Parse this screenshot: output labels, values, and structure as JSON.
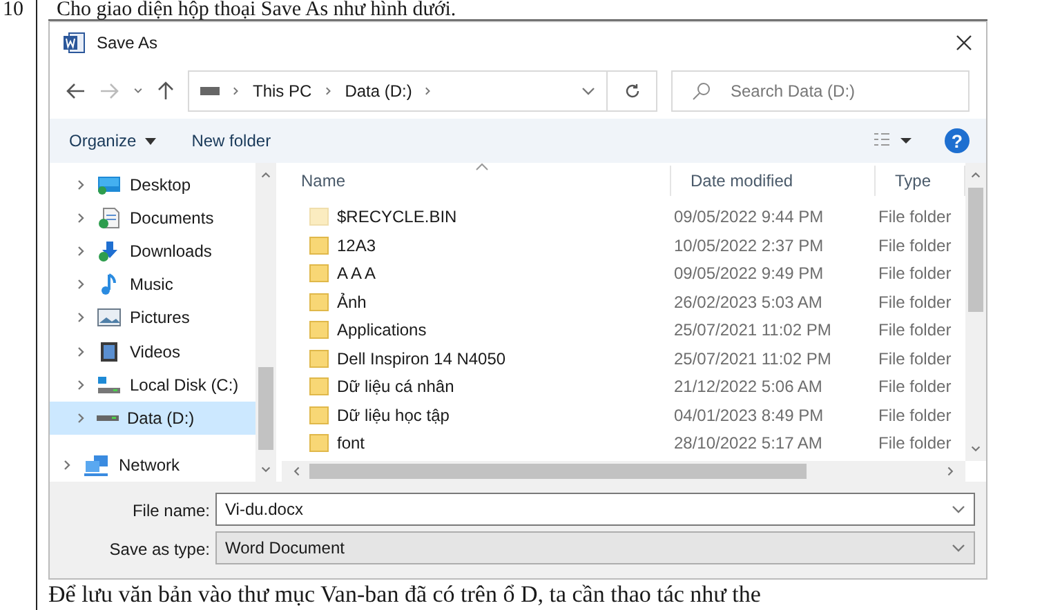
{
  "question": {
    "number": "10",
    "text": "Cho giao diện hộp thoại Save As như hình dưới."
  },
  "window": {
    "title": "Save As"
  },
  "address_bar": {
    "crumbs": [
      "This PC",
      "Data (D:)"
    ]
  },
  "search": {
    "placeholder": "Search Data (D:)"
  },
  "toolbar": {
    "organize": "Organize",
    "new_folder": "New folder",
    "help": "?"
  },
  "nav_pane": {
    "items": [
      {
        "label": "Desktop",
        "kind": "desktop",
        "selected": false
      },
      {
        "label": "Documents",
        "kind": "documents",
        "selected": false
      },
      {
        "label": "Downloads",
        "kind": "downloads",
        "selected": false
      },
      {
        "label": "Music",
        "kind": "music",
        "selected": false
      },
      {
        "label": "Pictures",
        "kind": "pictures",
        "selected": false
      },
      {
        "label": "Videos",
        "kind": "videos",
        "selected": false
      },
      {
        "label": "Local Disk (C:)",
        "kind": "system-drive",
        "selected": false
      },
      {
        "label": "Data (D:)",
        "kind": "drive",
        "selected": true
      }
    ],
    "other_items": [
      {
        "label": "Network",
        "kind": "network",
        "selected": false
      }
    ]
  },
  "file_list": {
    "columns": [
      "Name",
      "Date modified",
      "Type"
    ],
    "rows": [
      {
        "name": "$RECYCLE.BIN",
        "date": "09/05/2022 9:44 PM",
        "type": "File folder",
        "hidden": true
      },
      {
        "name": "12A3",
        "date": "10/05/2022 2:37 PM",
        "type": "File folder",
        "hidden": false
      },
      {
        "name": "A A A",
        "date": "09/05/2022 9:49 PM",
        "type": "File folder",
        "hidden": false
      },
      {
        "name": "Ảnh",
        "date": "26/02/2023 5:03 AM",
        "type": "File folder",
        "hidden": false
      },
      {
        "name": "Applications",
        "date": "25/07/2021 11:02 PM",
        "type": "File folder",
        "hidden": false
      },
      {
        "name": "Dell Inspiron 14 N4050",
        "date": "25/07/2021 11:02 PM",
        "type": "File folder",
        "hidden": false
      },
      {
        "name": "Dữ liệu cá nhân",
        "date": "21/12/2022 5:06 AM",
        "type": "File folder",
        "hidden": false
      },
      {
        "name": "Dữ liệu học tập",
        "date": "04/01/2023 8:49 PM",
        "type": "File folder",
        "hidden": false
      },
      {
        "name": "font",
        "date": "28/10/2022 5:17 AM",
        "type": "File folder",
        "hidden": false
      }
    ]
  },
  "file_name": {
    "label": "File name:",
    "value": "Vi-du.docx"
  },
  "save_as_type": {
    "label": "Save as type:",
    "value": "Word Document"
  },
  "footer_text": "Để lưu văn bản vào thư mục Van-ban đã có trên ổ D, ta cần thao tác như the"
}
